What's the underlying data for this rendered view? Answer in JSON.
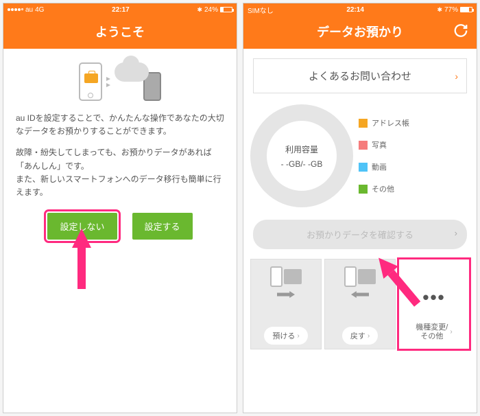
{
  "left": {
    "status": {
      "carrier": "au",
      "network": "4G",
      "time": "22:17",
      "battery": "24%"
    },
    "title": "ようこそ",
    "para1": "au IDを設定することで、かんたんな操作であなたの大切なデータをお預かりすることができます。",
    "para2": "故障・紛失してしまっても、お預かりデータがあれば「あんしん」です。\nまた、新しいスマートフォンへのデータ移行も簡単に行えます。",
    "btn_no": "設定しない",
    "btn_yes": "設定する"
  },
  "right": {
    "status": {
      "carrier": "SIMなし",
      "time": "22:14",
      "battery": "77%"
    },
    "title": "データお預かり",
    "faq": "よくあるお問い合わせ",
    "usage_label": "利用容量",
    "usage_value": "- -GB/- -GB",
    "legend": [
      {
        "label": "アドレス帳",
        "color": "#f5a623"
      },
      {
        "label": "写真",
        "color": "#f57c7c"
      },
      {
        "label": "動画",
        "color": "#4fc3f7"
      },
      {
        "label": "その他",
        "color": "#6ab82f"
      }
    ],
    "confirm": "お預かりデータを確認する",
    "bottom": {
      "deposit": "預ける",
      "restore": "戻す",
      "other": "機種変更/\nその他"
    }
  }
}
